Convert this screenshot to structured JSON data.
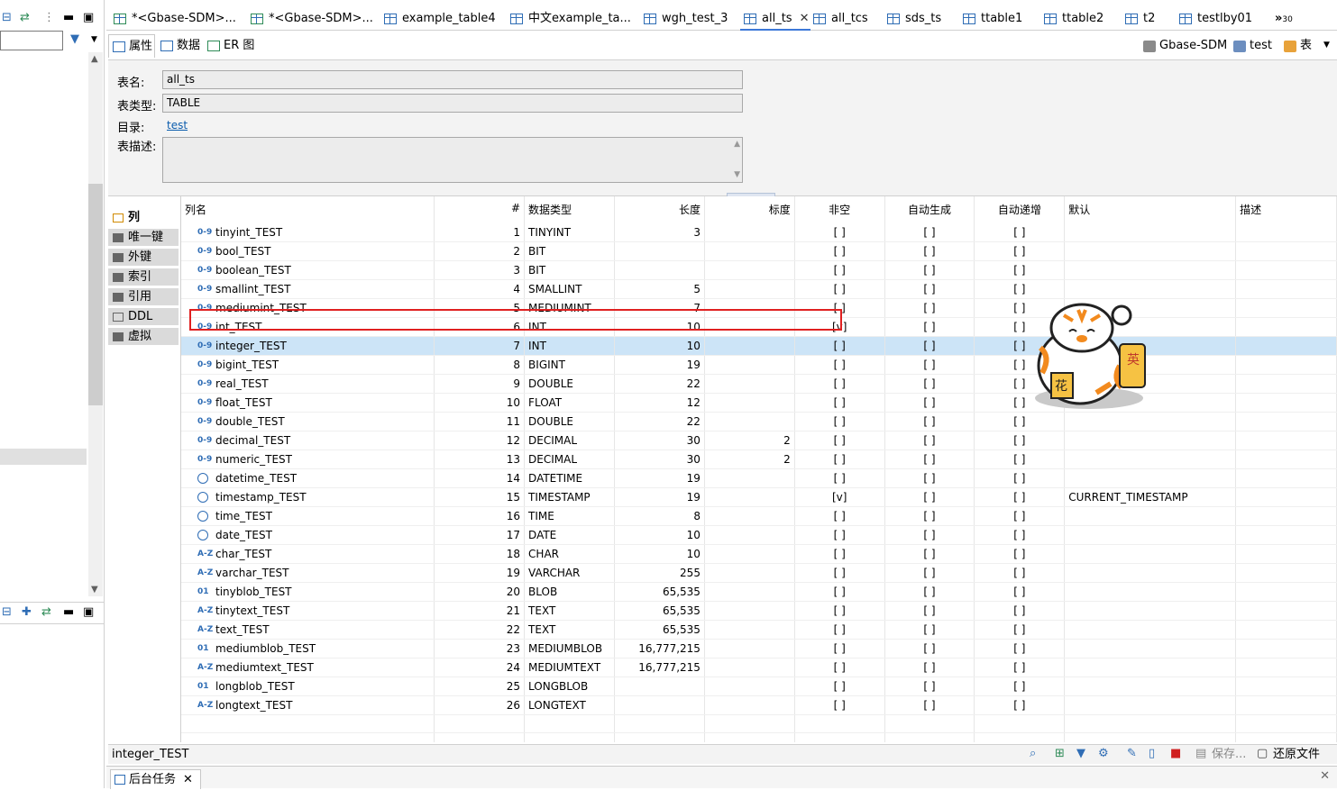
{
  "left_panel": {
    "filter_placeholder": ""
  },
  "tabs": [
    {
      "label": "*<Gbase-SDM>...",
      "edit": true
    },
    {
      "label": "*<Gbase-SDM>...",
      "edit": true
    },
    {
      "label": "example_table4"
    },
    {
      "label": "中文example_ta..."
    },
    {
      "label": "wgh_test_3"
    },
    {
      "label": "all_ts",
      "active": true
    },
    {
      "label": "all_tcs"
    },
    {
      "label": "sds_ts"
    },
    {
      "label": "ttable1"
    },
    {
      "label": "ttable2"
    },
    {
      "label": "t2"
    },
    {
      "label": "testlby01"
    }
  ],
  "tabs_more": {
    "glyph": "»",
    "count": "30"
  },
  "subtabs": {
    "props": "属性",
    "data": "数据",
    "er": "ER 图"
  },
  "conn": {
    "datasource": "Gbase-SDM",
    "db": "test",
    "type": "表"
  },
  "props": {
    "name_label": "表名:",
    "name_value": "all_ts",
    "type_label": "表类型:",
    "type_value": "TABLE",
    "catalog_label": "目录:",
    "catalog_value": "test",
    "desc_label": "表描述:"
  },
  "vtabs": [
    "列",
    "唯一键",
    "外键",
    "索引",
    "引用",
    "DDL",
    "虚拟"
  ],
  "columns": {
    "name": "列名",
    "num": "#",
    "type": "数据类型",
    "length": "长度",
    "scale": "标度",
    "notnull": "非空",
    "autogen": "自动生成",
    "autoinc": "自动递增",
    "default": "默认",
    "desc": "描述"
  },
  "rows": [
    {
      "icon": "0-9",
      "name": "tinyint_TEST",
      "num": "1",
      "type": "TINYINT",
      "length": "3",
      "scale": "",
      "notnull": "[ ]",
      "autogen": "[ ]",
      "autoinc": "[ ]",
      "default": ""
    },
    {
      "icon": "0-9",
      "name": "bool_TEST",
      "num": "2",
      "type": "BIT",
      "length": "",
      "scale": "",
      "notnull": "[ ]",
      "autogen": "[ ]",
      "autoinc": "[ ]",
      "default": ""
    },
    {
      "icon": "0-9",
      "name": "boolean_TEST",
      "num": "3",
      "type": "BIT",
      "length": "",
      "scale": "",
      "notnull": "[ ]",
      "autogen": "[ ]",
      "autoinc": "[ ]",
      "default": ""
    },
    {
      "icon": "0-9",
      "name": "smallint_TEST",
      "num": "4",
      "type": "SMALLINT",
      "length": "5",
      "scale": "",
      "notnull": "[ ]",
      "autogen": "[ ]",
      "autoinc": "[ ]",
      "default": ""
    },
    {
      "icon": "0-9",
      "name": "mediumint_TEST",
      "num": "5",
      "type": "MEDIUMINT",
      "length": "7",
      "scale": "",
      "notnull": "[ ]",
      "autogen": "[ ]",
      "autoinc": "[ ]",
      "default": ""
    },
    {
      "icon": "0-9",
      "name": "int_TEST",
      "num": "6",
      "type": "INT",
      "length": "10",
      "scale": "",
      "notnull": "[v]",
      "autogen": "[ ]",
      "autoinc": "[ ]",
      "default": ""
    },
    {
      "icon": "0-9",
      "name": "integer_TEST",
      "num": "7",
      "type": "INT",
      "length": "10",
      "scale": "",
      "notnull": "[ ]",
      "autogen": "[ ]",
      "autoinc": "[ ]",
      "default": "",
      "selected": true
    },
    {
      "icon": "0-9",
      "name": "bigint_TEST",
      "num": "8",
      "type": "BIGINT",
      "length": "19",
      "scale": "",
      "notnull": "[ ]",
      "autogen": "[ ]",
      "autoinc": "[ ]",
      "default": ""
    },
    {
      "icon": "0-9",
      "name": "real_TEST",
      "num": "9",
      "type": "DOUBLE",
      "length": "22",
      "scale": "",
      "notnull": "[ ]",
      "autogen": "[ ]",
      "autoinc": "[ ]",
      "default": ""
    },
    {
      "icon": "0-9",
      "name": "float_TEST",
      "num": "10",
      "type": "FLOAT",
      "length": "12",
      "scale": "",
      "notnull": "[ ]",
      "autogen": "[ ]",
      "autoinc": "[ ]",
      "default": ""
    },
    {
      "icon": "0-9",
      "name": "double_TEST",
      "num": "11",
      "type": "DOUBLE",
      "length": "22",
      "scale": "",
      "notnull": "[ ]",
      "autogen": "[ ]",
      "autoinc": "[ ]",
      "default": ""
    },
    {
      "icon": "0-9",
      "name": "decimal_TEST",
      "num": "12",
      "type": "DECIMAL",
      "length": "30",
      "scale": "2",
      "notnull": "[ ]",
      "autogen": "[ ]",
      "autoinc": "[ ]",
      "default": ""
    },
    {
      "icon": "0-9",
      "name": "numeric_TEST",
      "num": "13",
      "type": "DECIMAL",
      "length": "30",
      "scale": "2",
      "notnull": "[ ]",
      "autogen": "[ ]",
      "autoinc": "[ ]",
      "default": ""
    },
    {
      "icon": "clock",
      "name": "datetime_TEST",
      "num": "14",
      "type": "DATETIME",
      "length": "19",
      "scale": "",
      "notnull": "[ ]",
      "autogen": "[ ]",
      "autoinc": "[ ]",
      "default": ""
    },
    {
      "icon": "clock",
      "name": "timestamp_TEST",
      "num": "15",
      "type": "TIMESTAMP",
      "length": "19",
      "scale": "",
      "notnull": "[v]",
      "autogen": "[ ]",
      "autoinc": "[ ]",
      "default": "CURRENT_TIMESTAMP"
    },
    {
      "icon": "clock",
      "name": "time_TEST",
      "num": "16",
      "type": "TIME",
      "length": "8",
      "scale": "",
      "notnull": "[ ]",
      "autogen": "[ ]",
      "autoinc": "[ ]",
      "default": ""
    },
    {
      "icon": "clock",
      "name": "date_TEST",
      "num": "17",
      "type": "DATE",
      "length": "10",
      "scale": "",
      "notnull": "[ ]",
      "autogen": "[ ]",
      "autoinc": "[ ]",
      "default": ""
    },
    {
      "icon": "A-Z",
      "name": "char_TEST",
      "num": "18",
      "type": "CHAR",
      "length": "10",
      "scale": "",
      "notnull": "[ ]",
      "autogen": "[ ]",
      "autoinc": "[ ]",
      "default": ""
    },
    {
      "icon": "A-Z",
      "name": "varchar_TEST",
      "num": "19",
      "type": "VARCHAR",
      "length": "255",
      "scale": "",
      "notnull": "[ ]",
      "autogen": "[ ]",
      "autoinc": "[ ]",
      "default": ""
    },
    {
      "icon": "01",
      "name": "tinyblob_TEST",
      "num": "20",
      "type": "BLOB",
      "length": "65,535",
      "scale": "",
      "notnull": "[ ]",
      "autogen": "[ ]",
      "autoinc": "[ ]",
      "default": ""
    },
    {
      "icon": "A-Z",
      "name": "tinytext_TEST",
      "num": "21",
      "type": "TEXT",
      "length": "65,535",
      "scale": "",
      "notnull": "[ ]",
      "autogen": "[ ]",
      "autoinc": "[ ]",
      "default": ""
    },
    {
      "icon": "A-Z",
      "name": "text_TEST",
      "num": "22",
      "type": "TEXT",
      "length": "65,535",
      "scale": "",
      "notnull": "[ ]",
      "autogen": "[ ]",
      "autoinc": "[ ]",
      "default": ""
    },
    {
      "icon": "01",
      "name": "mediumblob_TEST",
      "num": "23",
      "type": "MEDIUMBLOB",
      "length": "16,777,215",
      "scale": "",
      "notnull": "[ ]",
      "autogen": "[ ]",
      "autoinc": "[ ]",
      "default": ""
    },
    {
      "icon": "A-Z",
      "name": "mediumtext_TEST",
      "num": "24",
      "type": "MEDIUMTEXT",
      "length": "16,777,215",
      "scale": "",
      "notnull": "[ ]",
      "autogen": "[ ]",
      "autoinc": "[ ]",
      "default": ""
    },
    {
      "icon": "01",
      "name": "longblob_TEST",
      "num": "25",
      "type": "LONGBLOB",
      "length": "",
      "scale": "",
      "notnull": "[ ]",
      "autogen": "[ ]",
      "autoinc": "[ ]",
      "default": ""
    },
    {
      "icon": "A-Z",
      "name": "longtext_TEST",
      "num": "26",
      "type": "LONGTEXT",
      "length": "",
      "scale": "",
      "notnull": "[ ]",
      "autogen": "[ ]",
      "autoinc": "[ ]",
      "default": ""
    }
  ],
  "sticker": {
    "tag1": "英",
    "tag2": "花"
  },
  "status": {
    "selected": "integer_TEST",
    "save": "保存...",
    "revert": "还原文件(V)"
  },
  "bottom": {
    "tab": "后台任务"
  },
  "colors": {
    "accent": "#3c78d8",
    "selection": "#cce4f7",
    "highlight_box": "#e02020"
  }
}
